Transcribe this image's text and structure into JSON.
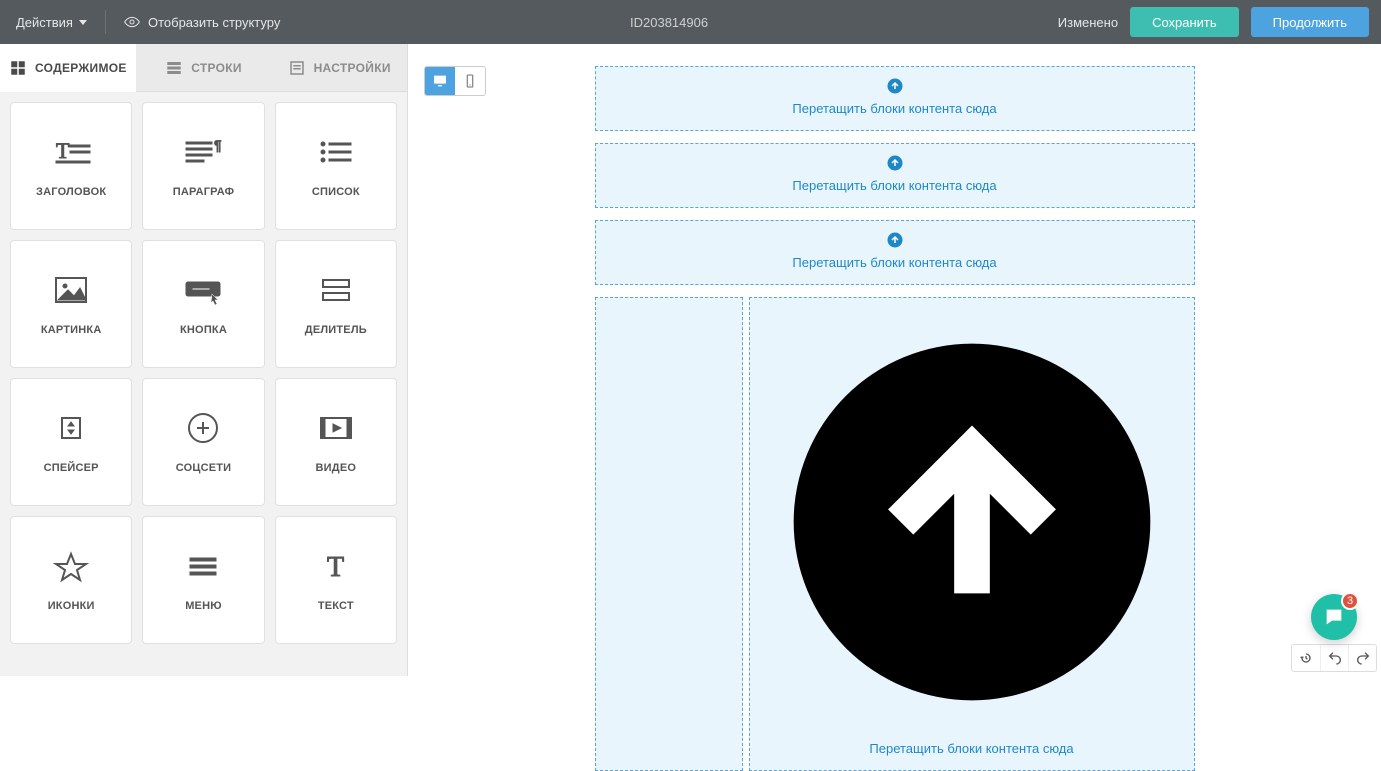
{
  "topbar": {
    "actions_label": "Действия",
    "show_structure_label": "Отобразить структуру",
    "doc_id": "ID203814906",
    "status": "Изменено",
    "save_label": "Сохранить",
    "continue_label": "Продолжить"
  },
  "tabs": {
    "content": "СОДЕРЖИМОЕ",
    "rows": "СТРОКИ",
    "settings": "НАСТРОЙКИ"
  },
  "blocks": [
    {
      "key": "heading",
      "label": "ЗАГОЛОВОК"
    },
    {
      "key": "paragraph",
      "label": "ПАРАГРАФ"
    },
    {
      "key": "list",
      "label": "СПИСОК"
    },
    {
      "key": "image",
      "label": "КАРТИНКА"
    },
    {
      "key": "button",
      "label": "КНОПКА"
    },
    {
      "key": "divider",
      "label": "ДЕЛИТЕЛЬ"
    },
    {
      "key": "spacer",
      "label": "СПЕЙСЕР"
    },
    {
      "key": "social",
      "label": "СОЦСЕТИ"
    },
    {
      "key": "video",
      "label": "ВИДЕО"
    },
    {
      "key": "icons",
      "label": "ИКОНКИ"
    },
    {
      "key": "menu",
      "label": "МЕНЮ"
    },
    {
      "key": "text",
      "label": "ТЕКСТ"
    }
  ],
  "canvas": {
    "drop_label": "Перетащить блоки контента сюда"
  },
  "chat": {
    "badge": "3"
  }
}
